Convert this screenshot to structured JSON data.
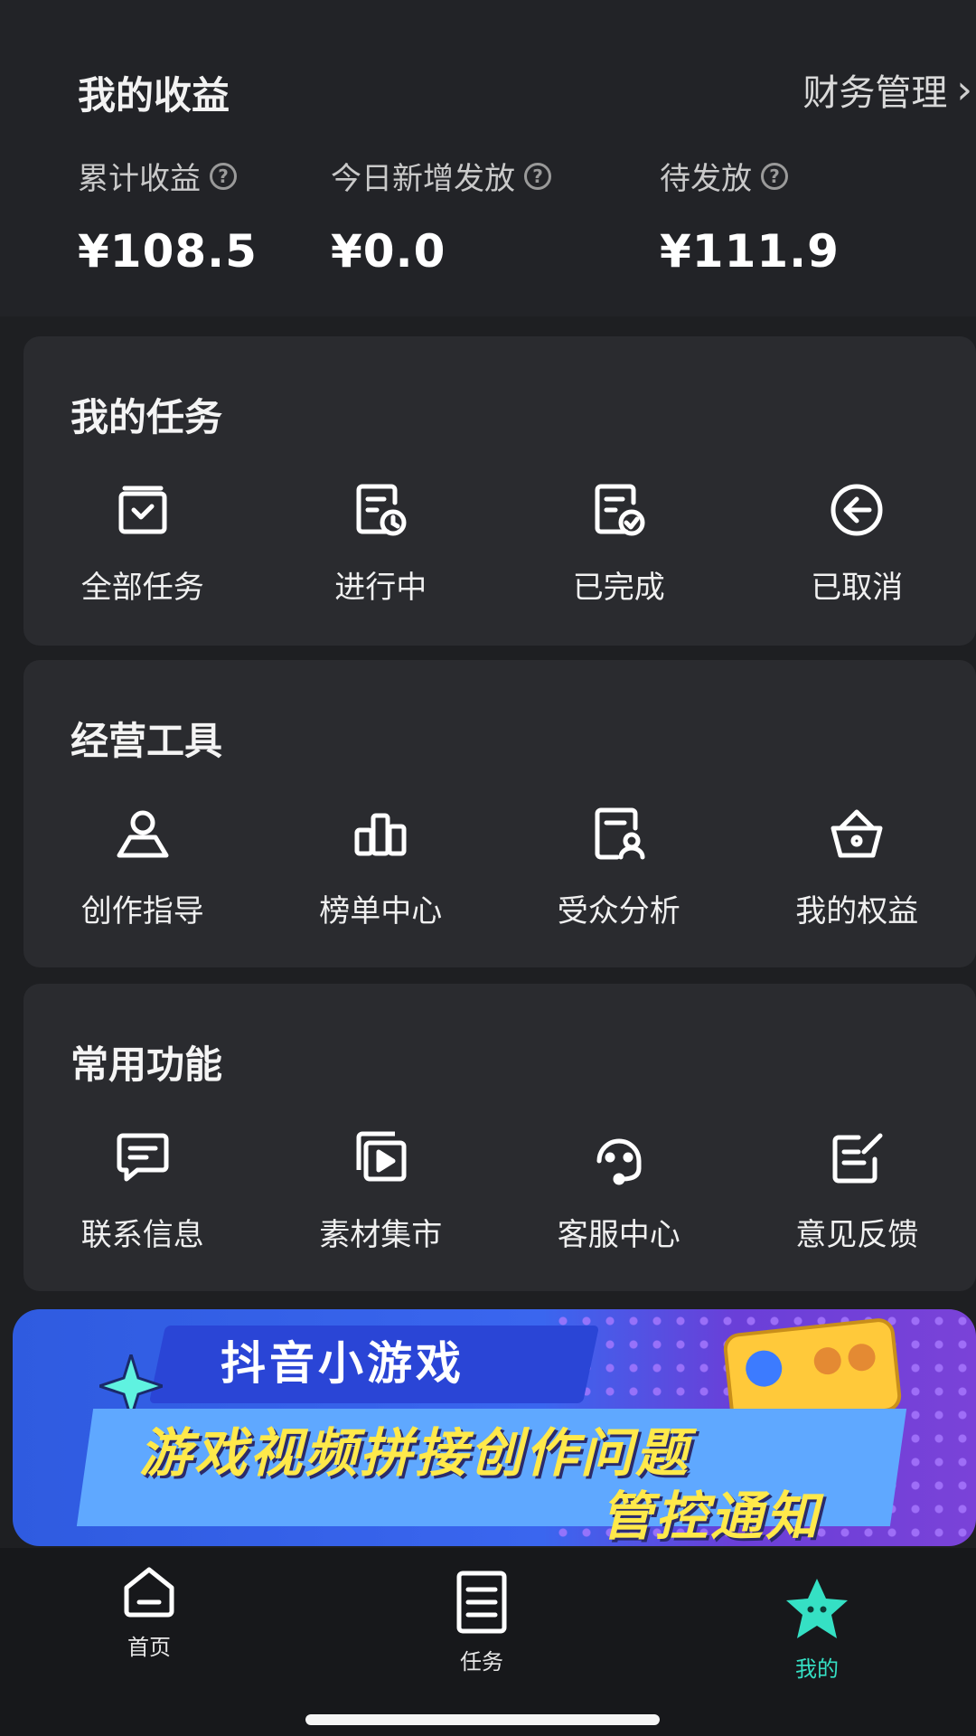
{
  "earnings": {
    "title": "我的收益",
    "finance_link": "财务管理",
    "stats": [
      {
        "label": "累计收益",
        "value": "¥108.5"
      },
      {
        "label": "今日新增发放",
        "value": "¥0.0"
      },
      {
        "label": "待发放",
        "value": "¥111.9"
      }
    ]
  },
  "tasks": {
    "title": "我的任务",
    "items": [
      {
        "label": "全部任务",
        "icon": "all-tasks-icon"
      },
      {
        "label": "进行中",
        "icon": "in-progress-icon"
      },
      {
        "label": "已完成",
        "icon": "completed-icon"
      },
      {
        "label": "已取消",
        "icon": "cancelled-icon"
      }
    ]
  },
  "tools": {
    "title": "经营工具",
    "items": [
      {
        "label": "创作指导",
        "icon": "creator-icon"
      },
      {
        "label": "榜单中心",
        "icon": "ranking-icon"
      },
      {
        "label": "受众分析",
        "icon": "audience-icon"
      },
      {
        "label": "我的权益",
        "icon": "crown-basket-icon"
      }
    ]
  },
  "common": {
    "title": "常用功能",
    "items": [
      {
        "label": "联系信息",
        "icon": "message-icon"
      },
      {
        "label": "素材集市",
        "icon": "video-library-icon"
      },
      {
        "label": "客服中心",
        "icon": "headset-icon"
      },
      {
        "label": "意见反馈",
        "icon": "feedback-edit-icon"
      }
    ]
  },
  "banner": {
    "title": "抖音小游戏",
    "line1": "游戏视频拼接创作问题",
    "line2": "管控通知"
  },
  "nav": {
    "home": "首页",
    "tasks": "任务",
    "mine": "我的"
  },
  "colors": {
    "background": "#1e1f22",
    "card": "#2a2b2f",
    "accent": "#35e0c4",
    "banner_blue": "#3a66ef",
    "banner_yellow": "#ffe94a"
  }
}
